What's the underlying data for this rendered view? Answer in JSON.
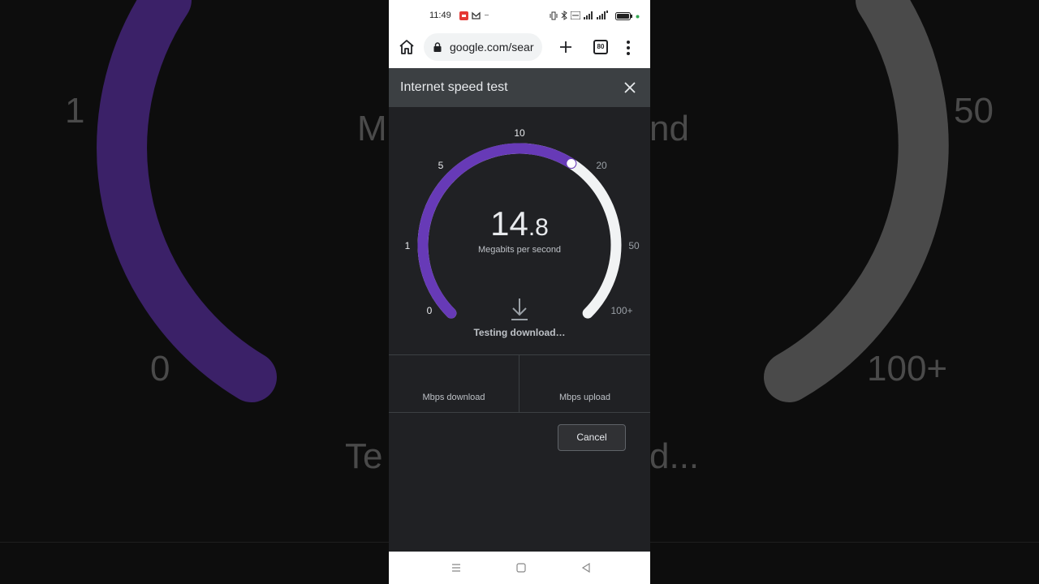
{
  "background": {
    "left_tick_1": "1",
    "left_tick_0": "0",
    "left_partial": "M",
    "left_partial_bottom": "Te",
    "right_tick_50": "50",
    "right_tick_100": "100+",
    "right_partial": "nd",
    "right_partial_bottom": "d..."
  },
  "status_bar": {
    "time": "11:49"
  },
  "browser": {
    "url": "google.com/sear",
    "tab_count": "80"
  },
  "dialog": {
    "title": "Internet speed test"
  },
  "gauge": {
    "ticks": {
      "t0": "0",
      "t1": "1",
      "t5": "5",
      "t10": "10",
      "t20": "20",
      "t50": "50",
      "t100": "100+"
    },
    "progress_fraction": 0.62,
    "value_int": "14",
    "value_dec": ".8",
    "unit": "Megabits per second",
    "status": "Testing download…",
    "active_color": "#673ab7",
    "track_color": "#f1f3f4"
  },
  "results": {
    "download_label": "Mbps download",
    "upload_label": "Mbps upload"
  },
  "actions": {
    "cancel_label": "Cancel"
  }
}
